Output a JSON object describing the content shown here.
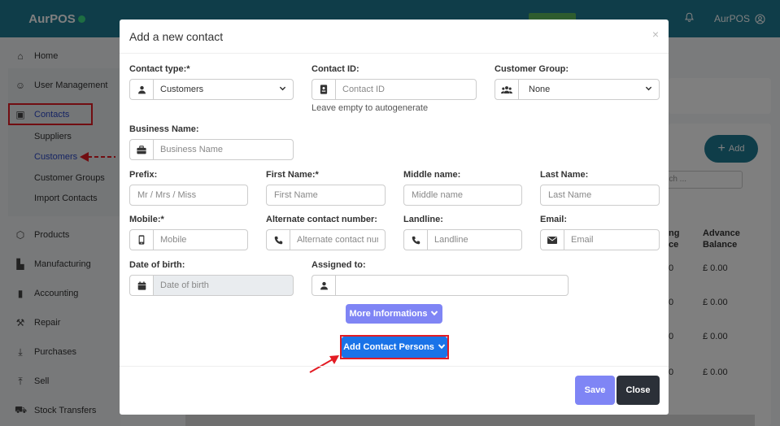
{
  "app": {
    "brand": "AurPOS",
    "user": "AurPOS"
  },
  "sidebar": {
    "items": [
      {
        "label": "Home",
        "icon": "home-icon"
      },
      {
        "label": "User Management",
        "icon": "users-icon"
      },
      {
        "label": "Contacts",
        "icon": "contacts-icon"
      },
      {
        "label": "Products",
        "icon": "box-icon"
      },
      {
        "label": "Manufacturing",
        "icon": "factory-icon"
      },
      {
        "label": "Accounting",
        "icon": "book-icon"
      },
      {
        "label": "Repair",
        "icon": "wrench-icon"
      },
      {
        "label": "Purchases",
        "icon": "download-icon"
      },
      {
        "label": "Sell",
        "icon": "upload-icon"
      },
      {
        "label": "Stock Transfers",
        "icon": "truck-icon"
      }
    ],
    "contacts_sub": [
      "Suppliers",
      "Customers",
      "Customer Groups",
      "Import Contacts"
    ]
  },
  "page": {
    "add_label": "Add",
    "search_placeholder": "rch ...",
    "columns": [
      {
        "line1": "ng",
        "line2": "ce"
      },
      {
        "line1": "Advance",
        "line2": "Balance"
      }
    ],
    "balances": [
      "£ 0.00",
      "£ 0.00",
      "£ 0.00",
      "£ 0.00"
    ],
    "partial_balances": [
      "0",
      "0",
      "0",
      "0"
    ]
  },
  "modal": {
    "title": "Add a new contact",
    "close_symbol": "×",
    "contact_type": {
      "label": "Contact type:*",
      "value": "Customers"
    },
    "contact_id": {
      "label": "Contact ID:",
      "placeholder": "Contact ID",
      "help": "Leave empty to autogenerate"
    },
    "customer_group": {
      "label": "Customer Group:",
      "value": "None"
    },
    "business_name": {
      "label": "Business Name:",
      "placeholder": "Business Name"
    },
    "prefix": {
      "label": "Prefix:",
      "placeholder": "Mr / Mrs / Miss"
    },
    "first_name": {
      "label": "First Name:*",
      "placeholder": "First Name"
    },
    "middle_name": {
      "label": "Middle name:",
      "placeholder": "Middle name"
    },
    "last_name": {
      "label": "Last Name:",
      "placeholder": "Last Name"
    },
    "mobile": {
      "label": "Mobile:*",
      "placeholder": "Mobile"
    },
    "alt_number": {
      "label": "Alternate contact number:",
      "placeholder": "Alternate contact number"
    },
    "landline": {
      "label": "Landline:",
      "placeholder": "Landline"
    },
    "email": {
      "label": "Email:",
      "placeholder": "Email"
    },
    "dob": {
      "label": "Date of birth:",
      "placeholder": "Date of birth"
    },
    "assigned_to": {
      "label": "Assigned to:",
      "value": ""
    },
    "more_info_label": "More Informations",
    "add_contact_persons_label": "Add Contact Persons",
    "save_label": "Save",
    "close_label": "Close"
  },
  "colors": {
    "topbar": "#1f7a93",
    "primary_blue": "#1a73e8",
    "light_purple": "#7f85f5",
    "dark": "#2b3038",
    "highlight_red": "#e31b23"
  }
}
